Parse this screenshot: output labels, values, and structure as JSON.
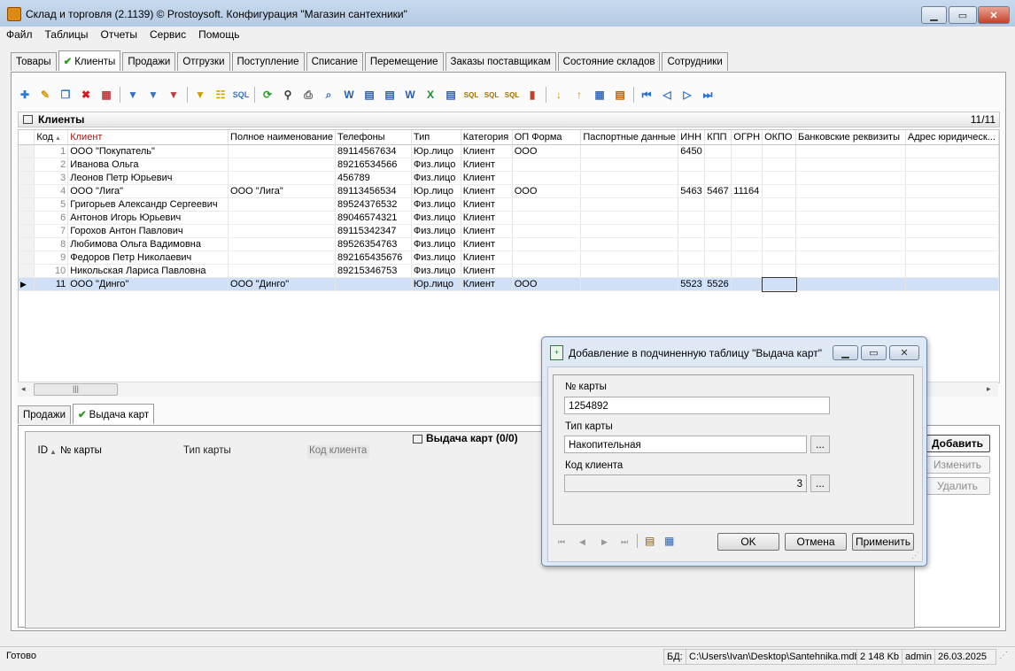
{
  "window": {
    "title": "Склад и торговля (2.1139) © Prostoysoft. Конфигурация \"Магазин сантехники\""
  },
  "menu": [
    "Файл",
    "Таблицы",
    "Отчеты",
    "Сервис",
    "Помощь"
  ],
  "main_tabs": [
    "Товары",
    "Клиенты",
    "Продажи",
    "Отгрузки",
    "Поступление",
    "Списание",
    "Перемещение",
    "Заказы поставщикам",
    "Состояние складов",
    "Сотрудники"
  ],
  "active_tab": "Клиенты",
  "grid": {
    "title": "Клиенты",
    "count": "11/11",
    "columns": [
      "Код",
      "Клиент",
      "Полное наименование",
      "Телефоны",
      "Тип",
      "Категория",
      "ОП Форма",
      "Паспортные данные",
      "ИНН",
      "КПП",
      "ОГРН",
      "ОКПО",
      "Банковские реквизиты",
      "Адрес юридическ..."
    ],
    "rows": [
      [
        "1",
        "ООО \"Покупатель\"",
        "",
        "89114567634",
        "Юр.лицо",
        "Клиент",
        "ООО",
        "",
        "6450",
        "",
        "",
        "",
        "",
        ""
      ],
      [
        "2",
        "Иванова Ольга",
        "",
        "89216534566",
        "Физ.лицо",
        "Клиент",
        "",
        "",
        "",
        "",
        "",
        "",
        "",
        ""
      ],
      [
        "3",
        "Леонов Петр Юрьевич",
        "",
        "456789",
        "Физ.лицо",
        "Клиент",
        "",
        "",
        "",
        "",
        "",
        "",
        "",
        ""
      ],
      [
        "4",
        "ООО \"Лига\"",
        "ООО \"Лига\"",
        "89113456534",
        "Юр.лицо",
        "Клиент",
        "ООО",
        "",
        "5463",
        "5467",
        "11164",
        "",
        "",
        ""
      ],
      [
        "5",
        "Григорьев Александр Сергеевич",
        "",
        "89524376532",
        "Физ.лицо",
        "Клиент",
        "",
        "",
        "",
        "",
        "",
        "",
        "",
        ""
      ],
      [
        "6",
        "Антонов Игорь Юрьевич",
        "",
        "89046574321",
        "Физ.лицо",
        "Клиент",
        "",
        "",
        "",
        "",
        "",
        "",
        "",
        ""
      ],
      [
        "7",
        "Горохов Антон Павлович",
        "",
        "89115342347",
        "Физ.лицо",
        "Клиент",
        "",
        "",
        "",
        "",
        "",
        "",
        "",
        ""
      ],
      [
        "8",
        "Любимова Ольга Вадимовна",
        "",
        "89526354763",
        "Физ.лицо",
        "Клиент",
        "",
        "",
        "",
        "",
        "",
        "",
        "",
        ""
      ],
      [
        "9",
        "Федоров Петр Николаевич",
        "",
        "892165435676",
        "Физ.лицо",
        "Клиент",
        "",
        "",
        "",
        "",
        "",
        "",
        "",
        ""
      ],
      [
        "10",
        "Никольская Лариса Павловна",
        "",
        "89215346753",
        "Физ.лицо",
        "Клиент",
        "",
        "",
        "",
        "",
        "",
        "",
        "",
        ""
      ],
      [
        "11",
        "ООО \"Динго\"",
        "ООО \"Динго\"",
        "",
        "Юр.лицо",
        "Клиент",
        "ООО",
        "",
        "5523",
        "5526",
        "",
        "",
        "",
        ""
      ]
    ],
    "selected_row": 11
  },
  "sub_tabs": [
    "Продажи",
    "Выдача карт"
  ],
  "sub_grid": {
    "title": "Выдача карт (0/0)",
    "columns": [
      "ID",
      "№ карты",
      "Тип карты",
      "Код клиента"
    ],
    "buttons": {
      "add": "Добавить",
      "edit": "Изменить",
      "delete": "Удалить"
    }
  },
  "dialog": {
    "title": "Добавление в подчиненную таблицу \"Выдача карт\"",
    "card_no_label": "№ карты",
    "card_no_value": "1254892",
    "card_type_label": "Тип карты",
    "card_type_value": "Накопительная",
    "client_code_label": "Код клиента",
    "client_code_value": "3",
    "ellipsis": "...",
    "ok": "OK",
    "cancel": "Отмена",
    "apply": "Применить"
  },
  "status": {
    "state": "Готово",
    "db_label": "БД:",
    "db_path": "C:\\Users\\Ivan\\Desktop\\Santehnika.mdb",
    "size": "2 148 Kb",
    "user": "admin",
    "date": "26.03.2025"
  },
  "colors": {
    "accent_check": "#2a9a1e",
    "selection": "#cfe0f7",
    "header_red_text": "#a31515"
  }
}
